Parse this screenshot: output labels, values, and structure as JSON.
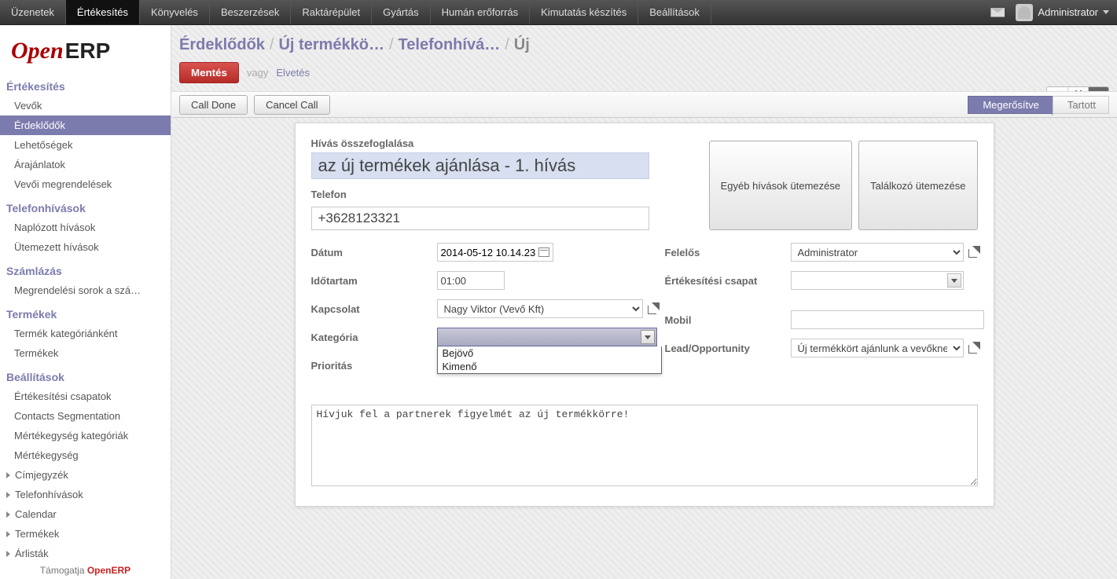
{
  "topbar": {
    "menus": [
      "Üzenetek",
      "Értékesítés",
      "Könyvelés",
      "Beszerzések",
      "Raktárépület",
      "Gyártás",
      "Humán erőforrás",
      "Kimutatás készítés",
      "Beállítások"
    ],
    "active_index": 1,
    "user": "Administrator"
  },
  "logo": {
    "left": "Open",
    "right": "ERP"
  },
  "sidebar": {
    "sections": [
      {
        "title": "Értékesítés",
        "items": [
          "Vevők",
          "Érdeklődők",
          "Lehetőségek",
          "Árajánlatok",
          "Vevői megrendelések"
        ],
        "active_item_index": 1
      },
      {
        "title": "Telefonhívások",
        "items": [
          "Naplózott hívások",
          "Ütemezett hívások"
        ]
      },
      {
        "title": "Számlázás",
        "items": [
          "Megrendelési sorok a szá…"
        ]
      },
      {
        "title": "Termékek",
        "items": [
          "Termék kategóriánként",
          "Termékek"
        ]
      },
      {
        "title": "Beállítások",
        "items": [
          "Értékesítési csapatok",
          "Contacts Segmentation",
          "Mértékegység kategóriák",
          "Mértékegység"
        ]
      }
    ],
    "collapsibles": [
      "Címjegyzék",
      "Telefonhívások",
      "Calendar",
      "Termékek",
      "Árlisták"
    ],
    "footer_leading": "Támogatja ",
    "footer_brand": "OpenERP"
  },
  "breadcrumb": {
    "parts": [
      "Érdeklődők",
      "Új termékkö…",
      "Telefonhívá…"
    ],
    "current": "Új"
  },
  "buttons": {
    "save": "Mentés",
    "or": "vagy",
    "discard": "Elvetés",
    "call_done": "Call Done",
    "cancel_call": "Cancel Call",
    "schedule_calls": "Egyéb hívások ütemezése",
    "schedule_meeting": "Találkozó ütemezése"
  },
  "status": {
    "confirmed": "Megerősítve",
    "held": "Tartott"
  },
  "form": {
    "summary_label": "Hívás összefoglalása",
    "summary_value": "az új termékek ajánlása - 1. hívás",
    "phone_label": "Telefon",
    "phone_value": "+3628123321",
    "date_label": "Dátum",
    "date_value": "2014-05-12 10.14.23",
    "duration_label": "Időtartam",
    "duration_value": "01:00",
    "contact_label": "Kapcsolat",
    "contact_value": "Nagy Viktor (Vevő Kft)",
    "category_label": "Kategória",
    "category_options": [
      "Bejövő",
      "Kimenő"
    ],
    "priority_label": "Prioritás",
    "responsible_label": "Felelős",
    "responsible_value": "Administrator",
    "salesteam_label": "Értékesítési csapat",
    "salesteam_value": "",
    "mobile_label": "Mobil",
    "mobile_value": "",
    "lead_label": "Lead/Opportunity",
    "lead_value": "Új termékkört ajánlunk a vevőknek",
    "notes_value": "Hívjuk fel a partnerek figyelmét az új termékkörre!"
  }
}
